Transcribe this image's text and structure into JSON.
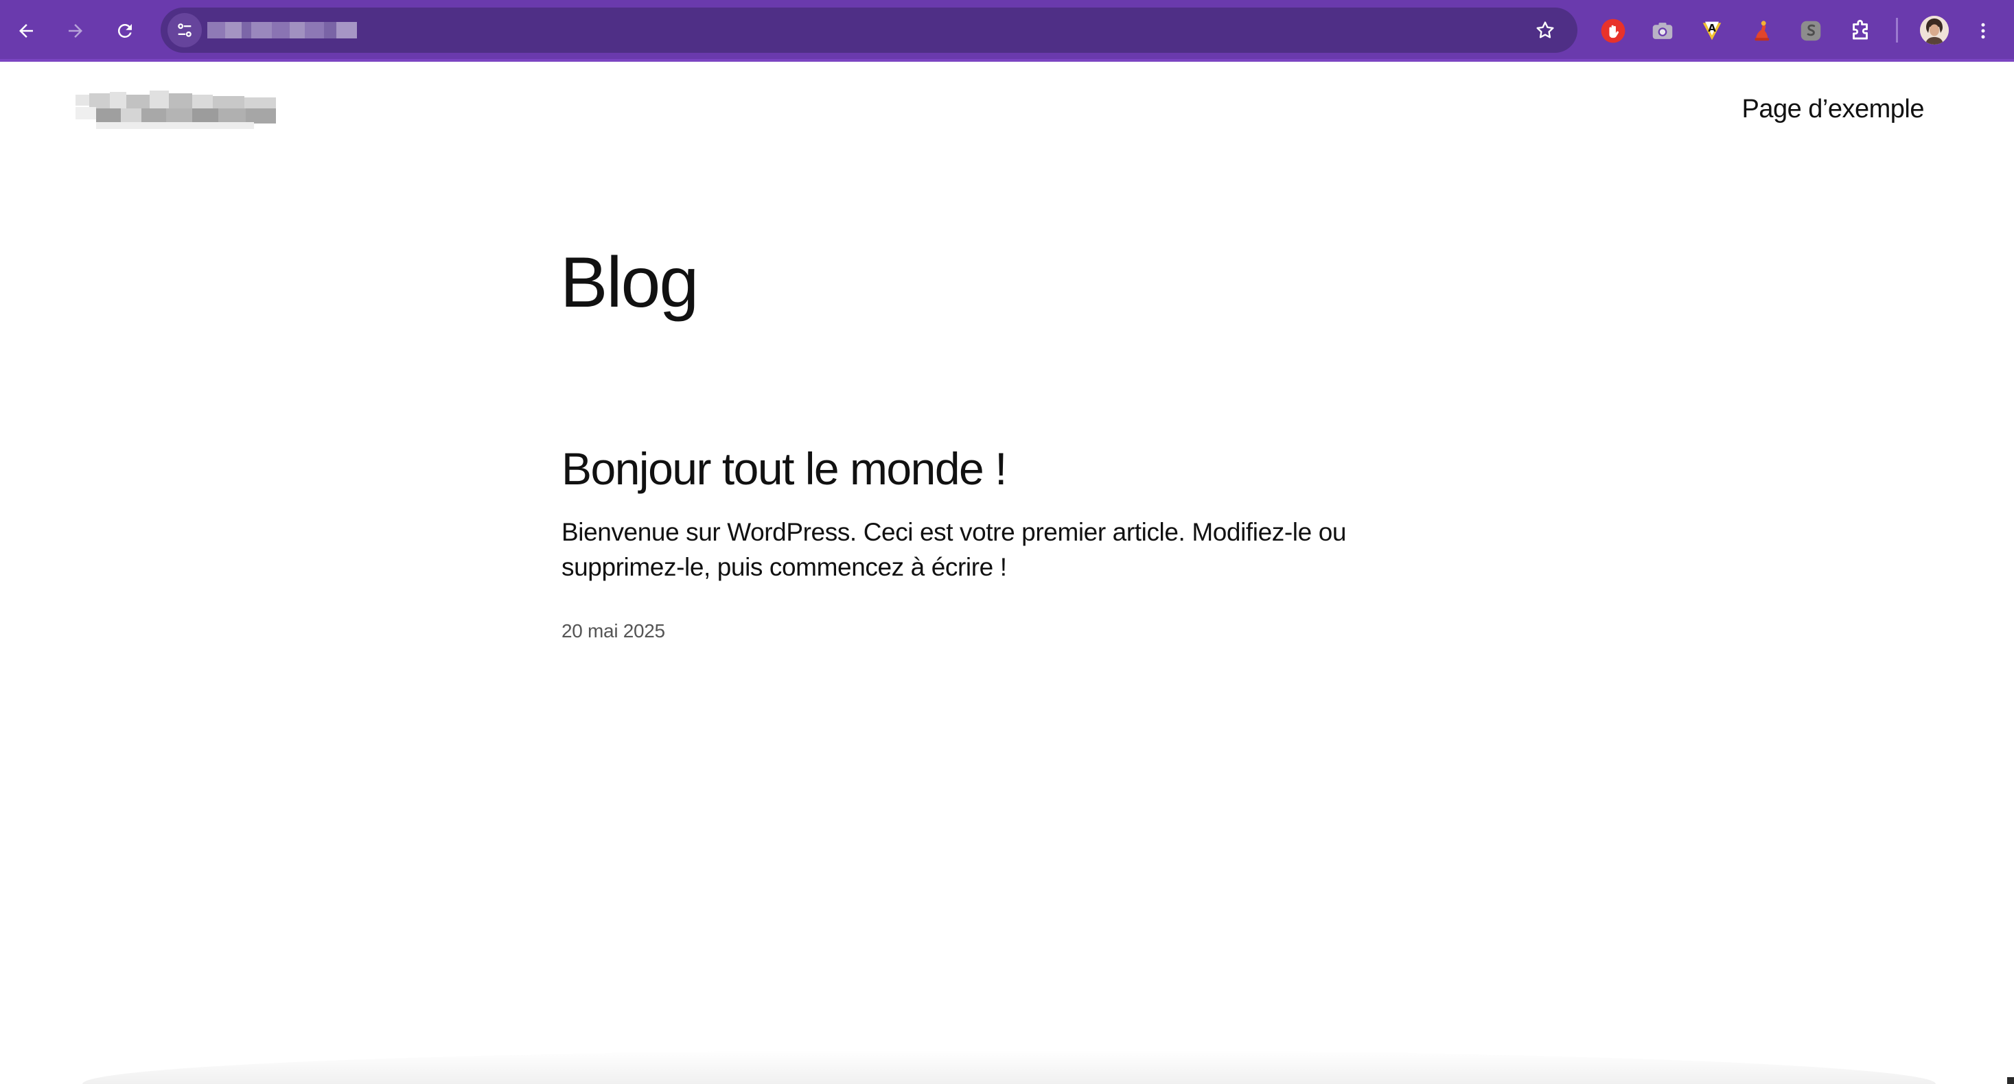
{
  "browser": {
    "toolbar_color": "#6a3aad",
    "omnibox_color": "#4f2f86",
    "back_icon": "arrow-left",
    "forward_icon": "arrow-right",
    "reload_icon": "reload",
    "site_settings_icon": "tune",
    "bookmark_icon": "star-outline",
    "extensions": [
      {
        "name": "red-hand-extension-icon",
        "color": "#e8322a"
      },
      {
        "name": "camera-extension-icon",
        "color": "#b9b3c6"
      },
      {
        "name": "a-badge-extension-icon",
        "color": "#f2c230"
      },
      {
        "name": "red-figure-extension-icon",
        "color": "#e2452c"
      },
      {
        "name": "grey-s-extension-icon",
        "color": "#8d8d8d"
      },
      {
        "name": "puzzle-extensions-icon",
        "color": "#ffffff"
      }
    ],
    "menu_icon": "three-dots-vertical"
  },
  "site": {
    "nav": {
      "link_label": "Page d’exemple"
    }
  },
  "main": {
    "page_title": "Blog",
    "posts": [
      {
        "title": "Bonjour tout le monde !",
        "excerpt": "Bienvenue sur WordPress. Ceci est votre premier article. Modifiez-le ou supprimez-le, puis commencez à écrire !",
        "date": "20 mai 2025"
      }
    ]
  }
}
